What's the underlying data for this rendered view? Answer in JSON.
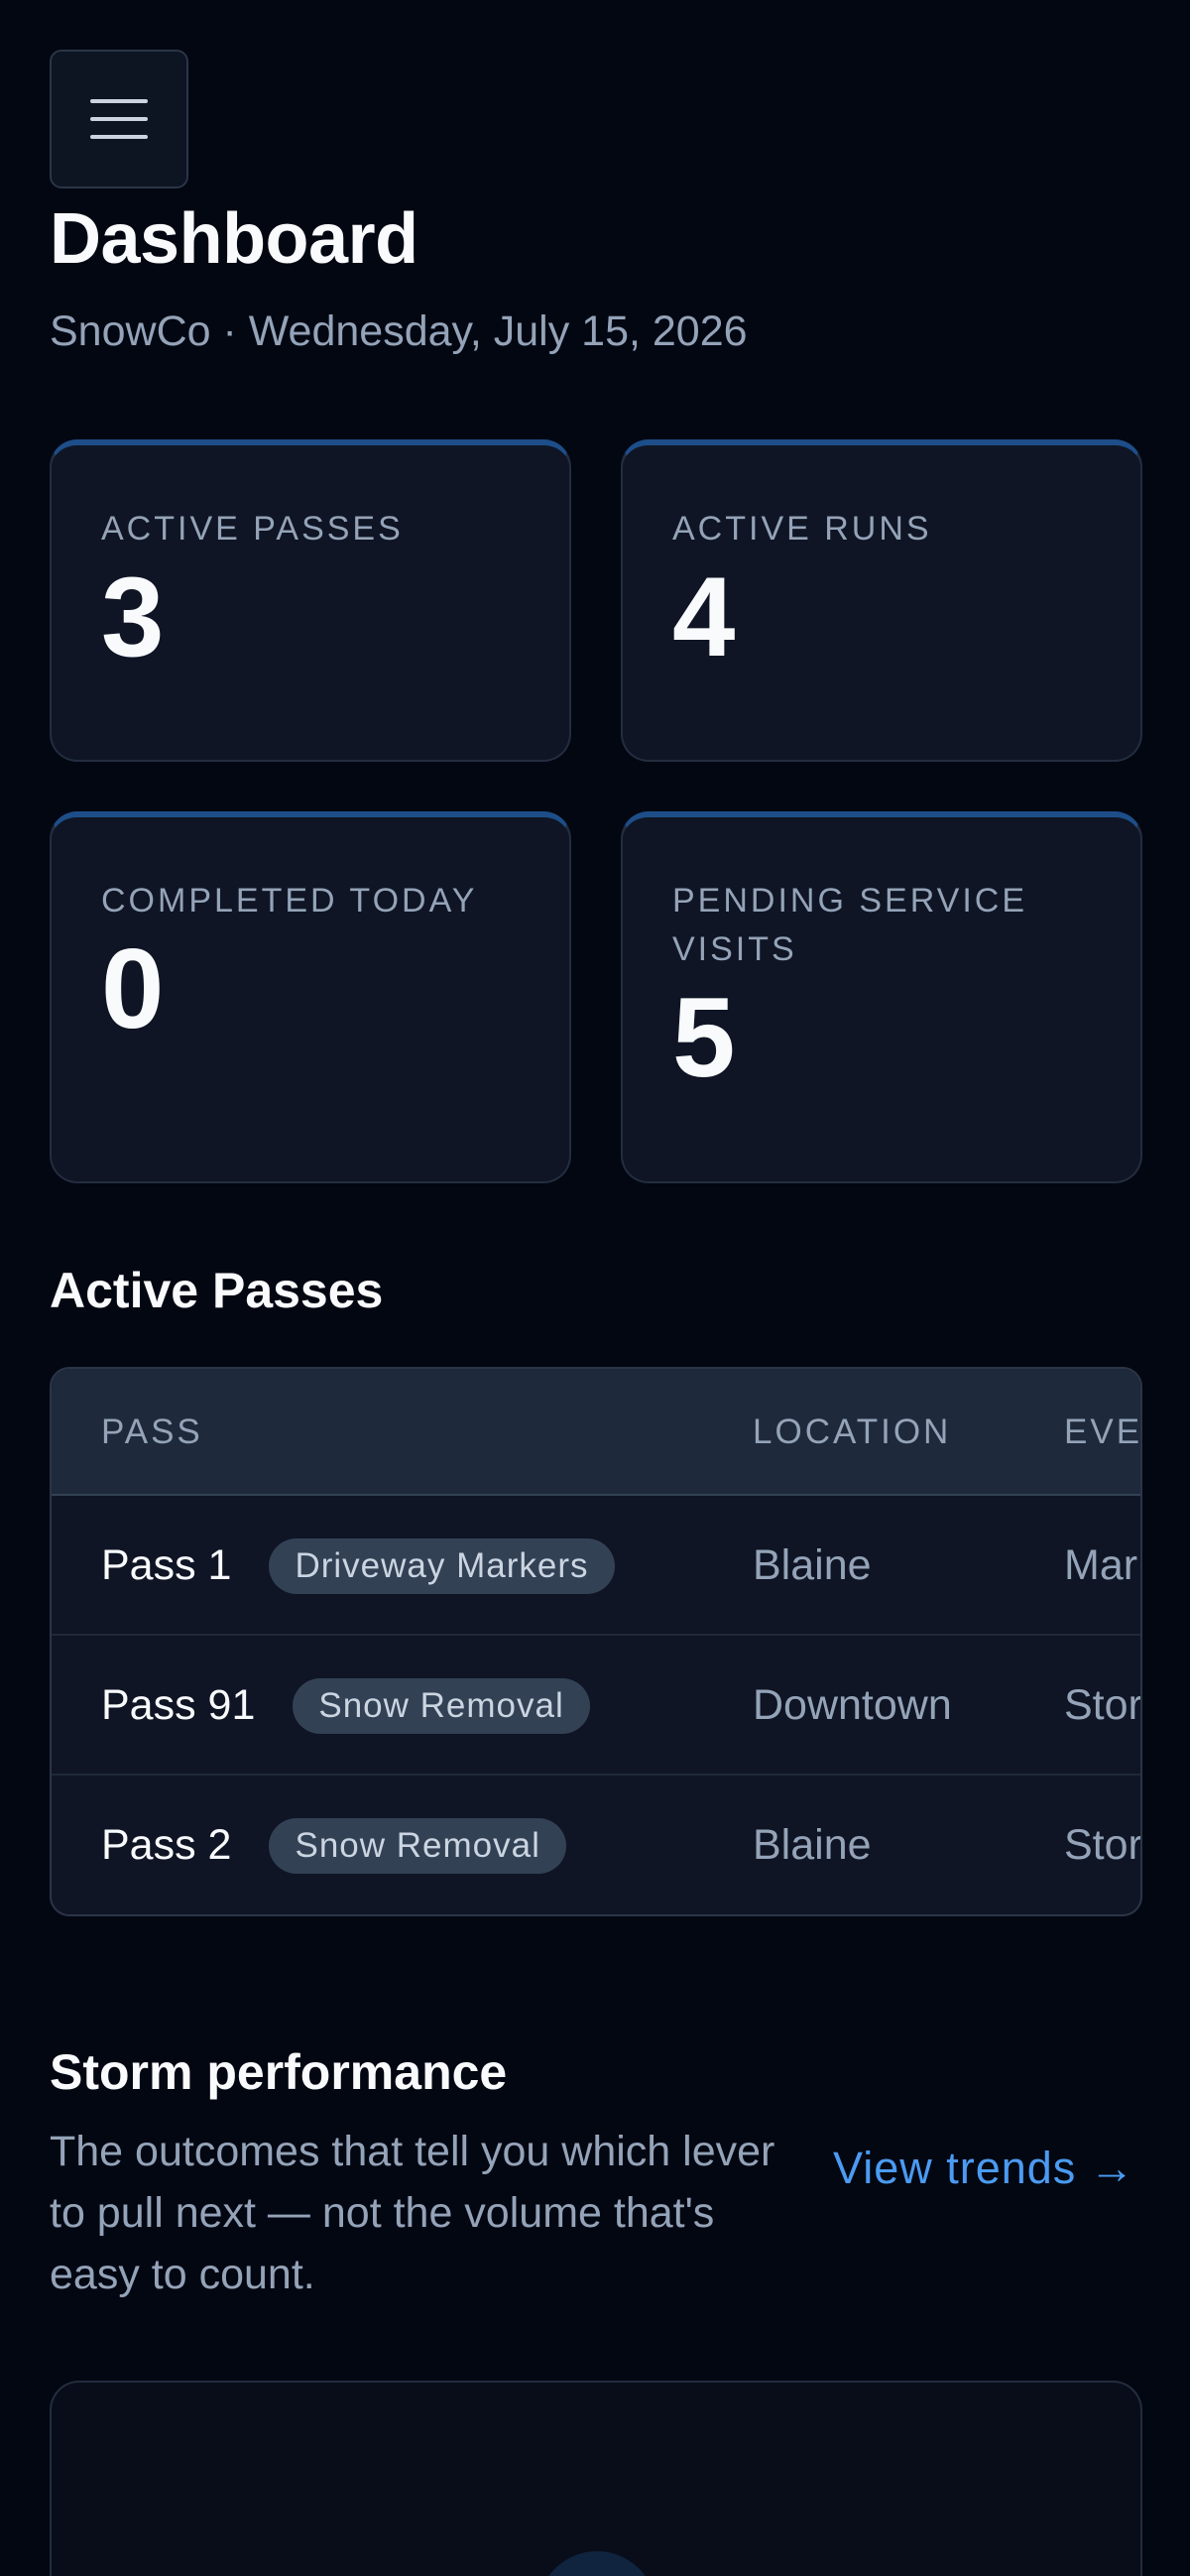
{
  "header": {
    "title": "Dashboard",
    "subtitle": "SnowCo · Wednesday, July 15, 2026"
  },
  "stats": [
    {
      "label": "ACTIVE PASSES",
      "value": "3"
    },
    {
      "label": "ACTIVE RUNS",
      "value": "4"
    },
    {
      "label": "COMPLETED TODAY",
      "value": "0"
    },
    {
      "label": "PENDING SERVICE VISITS",
      "value": "5"
    }
  ],
  "passes": {
    "title": "Active Passes",
    "columns": [
      "PASS",
      "LOCATION",
      "EVE"
    ],
    "rows": [
      {
        "pass": "Pass 1",
        "tag": "Driveway Markers",
        "location": "Blaine",
        "event": "Mar"
      },
      {
        "pass": "Pass 91",
        "tag": "Snow Removal",
        "location": "Downtown",
        "event": "Stor"
      },
      {
        "pass": "Pass 2",
        "tag": "Snow Removal",
        "location": "Blaine",
        "event": "Stor"
      }
    ]
  },
  "storm": {
    "title": "Storm performance",
    "description": "The outcomes that tell you which lever to pull next — not the volume that's easy to count.",
    "link_label": "View trends →"
  },
  "colors": {
    "background": "#030712",
    "card": "#0f1524",
    "accent": "#1d4e89",
    "link": "#4b9bf2"
  }
}
